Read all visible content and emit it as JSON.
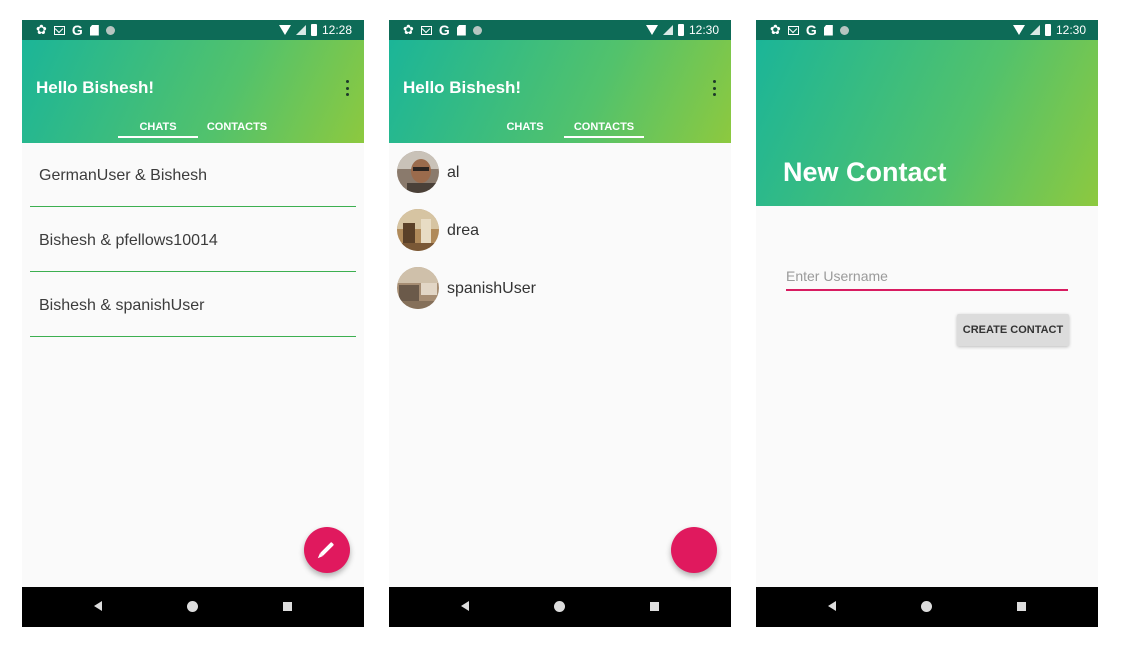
{
  "status_bars": [
    {
      "time": "12:28"
    },
    {
      "time": "12:30"
    },
    {
      "time": "12:30"
    }
  ],
  "main": {
    "greeting": "Hello Bishesh!",
    "tabs": [
      {
        "label": "CHATS"
      },
      {
        "label": "CONTACTS"
      }
    ]
  },
  "chats_screen": {
    "selected_tab": "CHATS",
    "chats": [
      {
        "title": "GermanUser & Bishesh"
      },
      {
        "title": "Bishesh & pfellows10014"
      },
      {
        "title": "Bishesh & spanishUser"
      }
    ],
    "fab_icon": "pencil-icon"
  },
  "contacts_screen": {
    "selected_tab": "CONTACTS",
    "contacts": [
      {
        "name": "al"
      },
      {
        "name": "drea"
      },
      {
        "name": "spanishUser"
      }
    ]
  },
  "new_contact_screen": {
    "title": "New Contact",
    "username_placeholder": "Enter Username",
    "create_button_label": "CREATE CONTACT"
  },
  "colors": {
    "status_bar": "#0d6b57",
    "gradient_start": "#1bb598",
    "gradient_end": "#8dc93f",
    "accent": "#e0195e",
    "divider": "#3caf50"
  }
}
